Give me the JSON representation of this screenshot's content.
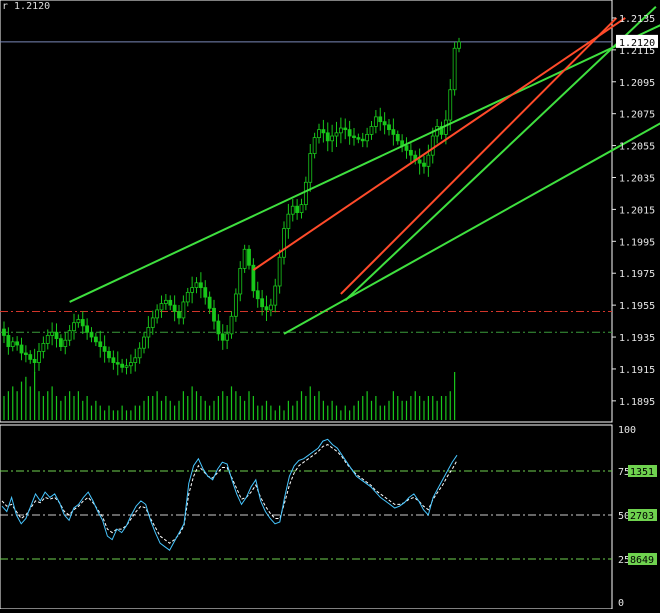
{
  "header": {
    "label": "r 1.2120"
  },
  "colors": {
    "background": "#000000",
    "candle": "#19c71b",
    "volume": "#19c71b",
    "channel_green": "#3fe03f",
    "channel_red": "#ff4b2a",
    "level_red": "#d2352a",
    "level_green": "#3b9b3b",
    "price_line": "#7a88b8",
    "axis_text": "#e6e6e6",
    "stoch_main": "#47c6ff",
    "stoch_signal": "#ffffff",
    "stoch_level": "#6fd24f",
    "current_box": "#ffffff",
    "level_box": "#6fd24f"
  },
  "chart_data": [
    {
      "type": "candlestick",
      "title": "",
      "y_ticks": [
        "1.2135",
        "1.2115",
        "1.2095",
        "1.2075",
        "1.2055",
        "1.2035",
        "1.2015",
        "1.1995",
        "1.1975",
        "1.1955",
        "1.1935",
        "1.1915",
        "1.1895"
      ],
      "current_price": "1.2120",
      "ylim": [
        1.1883,
        1.2145
      ],
      "horizontal_levels": [
        {
          "value": 1.1951,
          "style": "dash-dot",
          "color": "red"
        },
        {
          "value": 1.1938,
          "style": "dash-dot",
          "color": "green"
        }
      ],
      "close_series": [
        1.1936,
        1.1929,
        1.1932,
        1.193,
        1.1925,
        1.1924,
        1.1921,
        1.1919,
        1.1926,
        1.1931,
        1.1936,
        1.1938,
        1.1934,
        1.1929,
        1.1933,
        1.1939,
        1.1944,
        1.1946,
        1.1942,
        1.1938,
        1.1935,
        1.1932,
        1.1929,
        1.1926,
        1.1922,
        1.1919,
        1.1918,
        1.1916,
        1.1917,
        1.1919,
        1.1922,
        1.1928,
        1.1935,
        1.1941,
        1.1947,
        1.1952,
        1.1956,
        1.1958,
        1.1955,
        1.1951,
        1.1947,
        1.1957,
        1.1963,
        1.1966,
        1.1969,
        1.1966,
        1.196,
        1.1953,
        1.1945,
        1.1937,
        1.1933,
        1.1937,
        1.1948,
        1.1962,
        1.1978,
        1.199,
        1.198,
        1.1964,
        1.1959,
        1.1954,
        1.1952,
        1.1955,
        1.1967,
        1.1985,
        1.2003,
        1.2012,
        1.2017,
        1.2013,
        1.2018,
        1.2032,
        1.205,
        1.206,
        1.2065,
        1.2063,
        1.2058,
        1.2061,
        1.2063,
        1.2066,
        1.2065,
        1.2061,
        1.206,
        1.2059,
        1.2058,
        1.2062,
        1.2067,
        1.2073,
        1.207,
        1.2068,
        1.2065,
        1.2062,
        1.2058,
        1.2055,
        1.2052,
        1.2049,
        1.2046,
        1.2044,
        1.2042,
        1.2049,
        1.2061,
        1.2067,
        1.2062,
        1.2071,
        1.209,
        1.2116,
        1.212
      ],
      "volume": [
        0.5,
        0.6,
        0.7,
        0.6,
        0.8,
        0.9,
        0.7,
        1.0,
        0.6,
        0.5,
        0.6,
        0.7,
        0.5,
        0.4,
        0.5,
        0.6,
        0.5,
        0.6,
        0.4,
        0.5,
        0.3,
        0.4,
        0.3,
        0.2,
        0.3,
        0.2,
        0.2,
        0.3,
        0.2,
        0.2,
        0.3,
        0.3,
        0.4,
        0.5,
        0.5,
        0.6,
        0.4,
        0.5,
        0.4,
        0.3,
        0.4,
        0.6,
        0.5,
        0.7,
        0.6,
        0.5,
        0.4,
        0.3,
        0.4,
        0.5,
        0.6,
        0.5,
        0.7,
        0.6,
        0.5,
        0.4,
        0.6,
        0.5,
        0.3,
        0.3,
        0.4,
        0.3,
        0.2,
        0.3,
        0.2,
        0.4,
        0.3,
        0.4,
        0.6,
        0.5,
        0.7,
        0.5,
        0.6,
        0.4,
        0.3,
        0.4,
        0.3,
        0.2,
        0.3,
        0.2,
        0.3,
        0.4,
        0.5,
        0.6,
        0.4,
        0.5,
        0.3,
        0.3,
        0.4,
        0.6,
        0.5,
        0.4,
        0.4,
        0.5,
        0.6,
        0.5,
        0.4,
        0.5,
        0.5,
        0.4,
        0.5,
        0.5,
        0.6,
        1.0
      ],
      "channels": [
        {
          "color": "green",
          "from": [
            15,
            1.1957
          ],
          "to": [
            152,
            1.2133
          ]
        },
        {
          "color": "green",
          "from": [
            64,
            1.1937
          ],
          "to": [
            152,
            1.2072
          ]
        },
        {
          "color": "red",
          "from": [
            57,
            1.1977
          ],
          "to": [
            142,
            1.2135
          ]
        },
        {
          "color": "red",
          "from": [
            77,
            1.1962
          ],
          "to": [
            140,
            1.2135
          ]
        },
        {
          "color": "green",
          "from": [
            78,
            1.1958
          ],
          "to": [
            149,
            1.2142
          ]
        }
      ]
    },
    {
      "type": "line",
      "title": "",
      "y_ticks": [
        "100",
        "75",
        "50",
        "25",
        "0"
      ],
      "ylim": [
        0,
        100
      ],
      "levels": [
        {
          "value": 75,
          "label": "1351"
        },
        {
          "value": 50,
          "label": "2703"
        },
        {
          "value": 25,
          "label": "8649"
        }
      ],
      "series": [
        {
          "values": [
            55,
            52,
            60,
            50,
            45,
            48,
            55,
            62,
            58,
            63,
            60,
            62,
            57,
            50,
            47,
            54,
            56,
            60,
            63,
            58,
            52,
            47,
            38,
            36,
            42,
            40,
            44,
            50,
            55,
            58,
            56,
            47,
            40,
            34,
            32,
            30,
            35,
            40,
            45,
            68,
            78,
            82,
            76,
            72,
            70,
            76,
            80,
            79,
            70,
            62,
            56,
            60,
            66,
            70,
            58,
            52,
            48,
            45,
            46,
            60,
            72,
            78,
            81,
            82,
            84,
            86,
            88,
            92,
            93,
            90,
            88,
            84,
            80,
            76,
            72,
            70,
            68,
            66,
            63,
            60,
            58,
            56,
            54,
            55,
            57,
            60,
            62,
            58,
            53,
            50,
            60,
            65,
            70,
            75,
            80,
            84
          ]
        },
        {
          "values": [
            58,
            55,
            56,
            52,
            48,
            50,
            54,
            58,
            57,
            60,
            59,
            60,
            57,
            52,
            50,
            53,
            55,
            58,
            60,
            57,
            53,
            49,
            42,
            40,
            42,
            42,
            44,
            48,
            52,
            55,
            54,
            48,
            43,
            38,
            36,
            34,
            36,
            39,
            44,
            62,
            72,
            78,
            75,
            72,
            71,
            74,
            77,
            77,
            71,
            65,
            59,
            60,
            63,
            67,
            60,
            55,
            51,
            48,
            48,
            57,
            67,
            74,
            78,
            80,
            82,
            84,
            86,
            89,
            90,
            88,
            86,
            83,
            79,
            76,
            73,
            71,
            69,
            67,
            64,
            62,
            60,
            58,
            56,
            56,
            57,
            59,
            60,
            58,
            55,
            53,
            59,
            63,
            67,
            72,
            76,
            81
          ]
        }
      ]
    }
  ]
}
